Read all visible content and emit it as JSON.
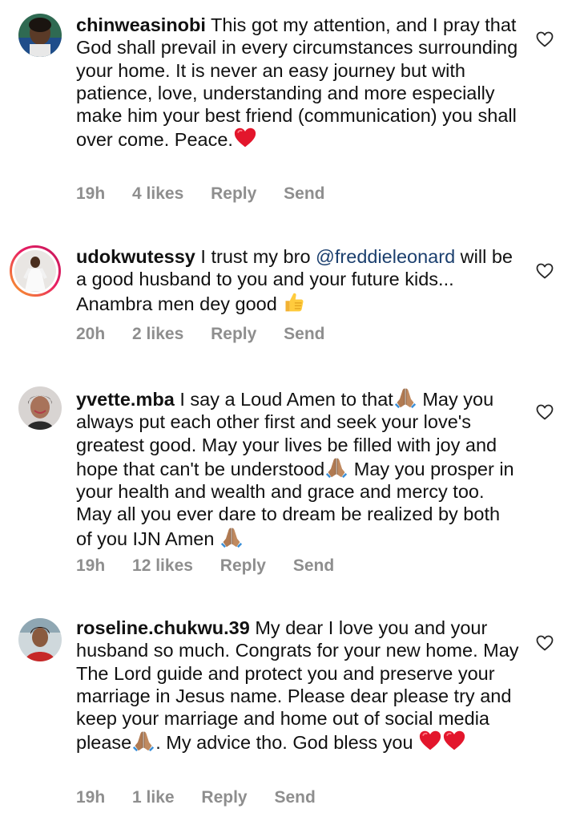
{
  "comments": [
    {
      "username": "chinweasinobi",
      "text": "This got my attention, and I pray that God shall prevail in every circumstances  surrounding your home. It is never an easy journey but with patience, love, understanding and more especially make him your best friend (communication) you shall over come. Peace.",
      "time": "19h",
      "likes": "4 likes",
      "reply_label": "Reply",
      "send_label": "Send"
    },
    {
      "username": "udokwutessy",
      "text_before": "I trust my bro ",
      "mention": "@freddieleonard",
      "text_after": " will be a good husband to you and your future kids... Anambra men dey good",
      "time": "20h",
      "likes": "2 likes",
      "reply_label": "Reply",
      "send_label": "Send"
    },
    {
      "username": "yvette.mba",
      "text_1": "I say a Loud Amen to that",
      "text_2": " May you always put each other first and seek your love's greatest good. May your lives be filled with joy and hope that can't be understood",
      "text_3": " May you prosper in your health and wealth and grace and mercy too. May all you ever dare to dream be realized by both of you IJN Amen ",
      "time": "19h",
      "likes": "12 likes",
      "reply_label": "Reply",
      "send_label": "Send"
    },
    {
      "username": "roseline.chukwu.39",
      "text_1": "My dear I love you and your husband so much. Congrats for your new home. May The Lord guide and protect you and preserve your marriage in Jesus name. Please dear please  try and keep your marriage and home out of social media please",
      "text_2": ". My advice tho. God bless you ",
      "time": "19h",
      "likes": "1 like",
      "reply_label": "Reply",
      "send_label": "Send"
    }
  ],
  "icons": {
    "like": "heart-outline-icon",
    "emoji_heart": "red-heart-emoji",
    "emoji_thumb": "thumbs-up-emoji",
    "emoji_pray": "folded-hands-emoji"
  },
  "colors": {
    "text": "#111111",
    "meta": "#8e8e8e",
    "mention": "#1b3f6e",
    "heart_emoji": "#e3162c",
    "story_ring_start": "#f9a825",
    "story_ring_end": "#c2185b"
  }
}
